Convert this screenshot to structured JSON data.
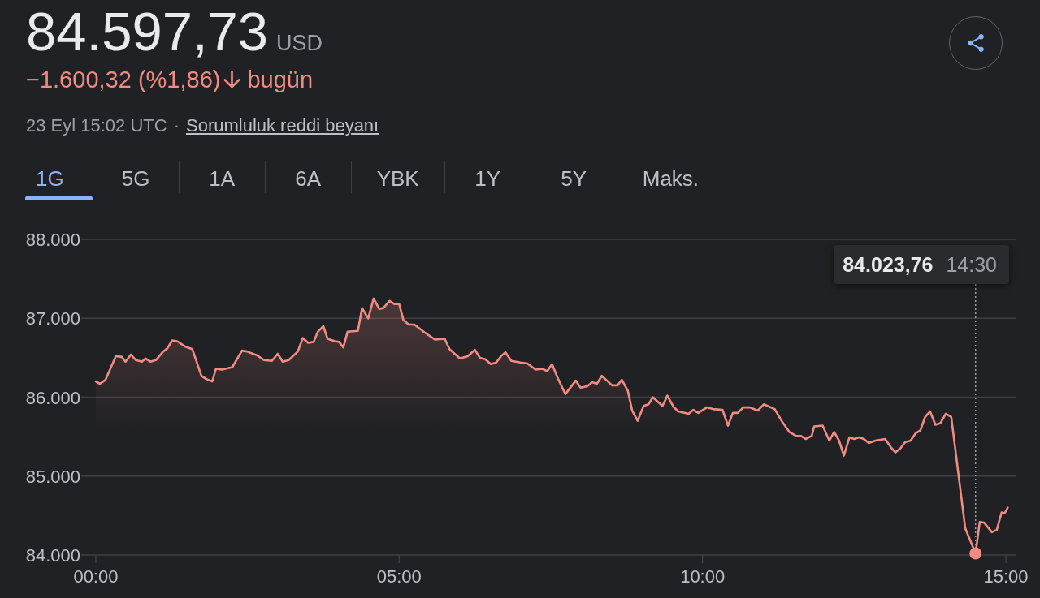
{
  "quote": {
    "price": "84.597,73",
    "currency": "USD",
    "change": "−1.600,32 (%1,86)",
    "negative": true,
    "change_period": "bugün",
    "timestamp": "23 Eyl 15:02 UTC",
    "separator": "·",
    "disclaimer_link": "Sorumluluk reddi beyanı"
  },
  "range_tabs": [
    {
      "label": "1G",
      "selected": true
    },
    {
      "label": "5G",
      "selected": false
    },
    {
      "label": "1A",
      "selected": false
    },
    {
      "label": "6A",
      "selected": false
    },
    {
      "label": "YBK",
      "selected": false
    },
    {
      "label": "1Y",
      "selected": false
    },
    {
      "label": "5Y",
      "selected": false
    },
    {
      "label": "Maks.",
      "selected": false
    }
  ],
  "chart": {
    "tooltip": {
      "value": "84.023,76",
      "time": "14:30"
    },
    "chart_data": {
      "type": "area",
      "grid": true,
      "x": [
        0,
        0.07,
        0.16,
        0.33,
        0.43,
        0.49,
        0.58,
        0.66,
        0.76,
        0.82,
        0.9,
        0.99,
        1.1,
        1.18,
        1.26,
        1.34,
        1.48,
        1.59,
        1.74,
        1.82,
        1.92,
        1.98,
        2.08,
        2.25,
        2.41,
        2.49,
        2.66,
        2.77,
        2.9,
        3,
        3.08,
        3.18,
        3.33,
        3.41,
        3.5,
        3.59,
        3.66,
        3.75,
        3.82,
        3.94,
        4.01,
        4.08,
        4.15,
        4.32,
        4.39,
        4.49,
        4.58,
        4.67,
        4.74,
        4.84,
        4.92,
        5,
        5.07,
        5.16,
        5.25,
        5.42,
        5.59,
        5.75,
        5.83,
        6,
        6.13,
        6.25,
        6.33,
        6.42,
        6.51,
        6.6,
        6.68,
        6.75,
        6.85,
        7,
        7.11,
        7.25,
        7.36,
        7.44,
        7.52,
        7.61,
        7.74,
        7.91,
        7.99,
        8.1,
        8.18,
        8.26,
        8.34,
        8.51,
        8.6,
        8.67,
        8.77,
        8.84,
        8.93,
        9.03,
        9.11,
        9.18,
        9.34,
        9.42,
        9.52,
        9.6,
        9.77,
        9.85,
        9.93,
        10.07,
        10.17,
        10.33,
        10.42,
        10.5,
        10.58,
        10.67,
        10.78,
        10.91,
        11.01,
        11.19,
        11.32,
        11.43,
        11.54,
        11.62,
        11.7,
        11.8,
        11.84,
        11.98,
        12.09,
        12.17,
        12.25,
        12.33,
        12.42,
        12.5,
        12.58,
        12.66,
        12.74,
        12.85,
        13.01,
        13.1,
        13.18,
        13.26,
        13.34,
        13.43,
        13.51,
        13.59,
        13.67,
        13.75,
        13.84,
        13.92,
        14.01,
        14.1,
        14.33,
        14.5,
        14.57,
        14.64,
        14.77,
        14.85,
        14.93,
        14.98,
        15.03
      ],
      "series": [
        {
          "color": "#f28b82",
          "values": [
            86200,
            86170,
            86220,
            86520,
            86510,
            86450,
            86540,
            86470,
            86450,
            86490,
            86450,
            86470,
            86570,
            86620,
            86720,
            86710,
            86640,
            86610,
            86270,
            86230,
            86200,
            86360,
            86350,
            86380,
            86590,
            86580,
            86530,
            86470,
            86460,
            86550,
            86450,
            86470,
            86580,
            86750,
            86690,
            86700,
            86830,
            86900,
            86740,
            86710,
            86700,
            86630,
            86830,
            86840,
            87130,
            87000,
            87250,
            87120,
            87130,
            87220,
            87180,
            87180,
            86980,
            86920,
            86920,
            86820,
            86730,
            86740,
            86610,
            86490,
            86520,
            86600,
            86500,
            86480,
            86420,
            86440,
            86520,
            86570,
            86460,
            86440,
            86430,
            86350,
            86360,
            86330,
            86420,
            86250,
            86040,
            86210,
            86120,
            86140,
            86190,
            86170,
            86270,
            86150,
            86150,
            86220,
            86080,
            85830,
            85700,
            85890,
            85910,
            86000,
            85890,
            86020,
            85880,
            85820,
            85790,
            85840,
            85800,
            85870,
            85850,
            85840,
            85640,
            85800,
            85800,
            85870,
            85870,
            85830,
            85910,
            85850,
            85680,
            85560,
            85510,
            85510,
            85470,
            85510,
            85630,
            85640,
            85450,
            85560,
            85450,
            85260,
            85490,
            85470,
            85490,
            85470,
            85420,
            85450,
            85470,
            85370,
            85300,
            85350,
            85430,
            85450,
            85540,
            85580,
            85750,
            85820,
            85650,
            85670,
            85790,
            85750,
            84340,
            84020,
            84420,
            84410,
            84290,
            84320,
            84540,
            84530,
            84600
          ]
        }
      ],
      "xlim": [
        -0.24,
        15.16
      ],
      "ylim": [
        84000,
        88000
      ],
      "xticks": [
        {
          "value": 0,
          "label": "00:00"
        },
        {
          "value": 5,
          "label": "05:00"
        },
        {
          "value": 10,
          "label": "10:00"
        },
        {
          "value": 15,
          "label": "15:00"
        }
      ],
      "yticks": [
        {
          "value": 84000,
          "label": "84.000"
        },
        {
          "value": 85000,
          "label": "85.000"
        },
        {
          "value": 86000,
          "label": "86.000"
        },
        {
          "value": 87000,
          "label": "87.000"
        },
        {
          "value": 88000,
          "label": "88.000"
        }
      ],
      "ref_lines": [
        {
          "axis": "x",
          "value": 14.5
        }
      ]
    }
  }
}
